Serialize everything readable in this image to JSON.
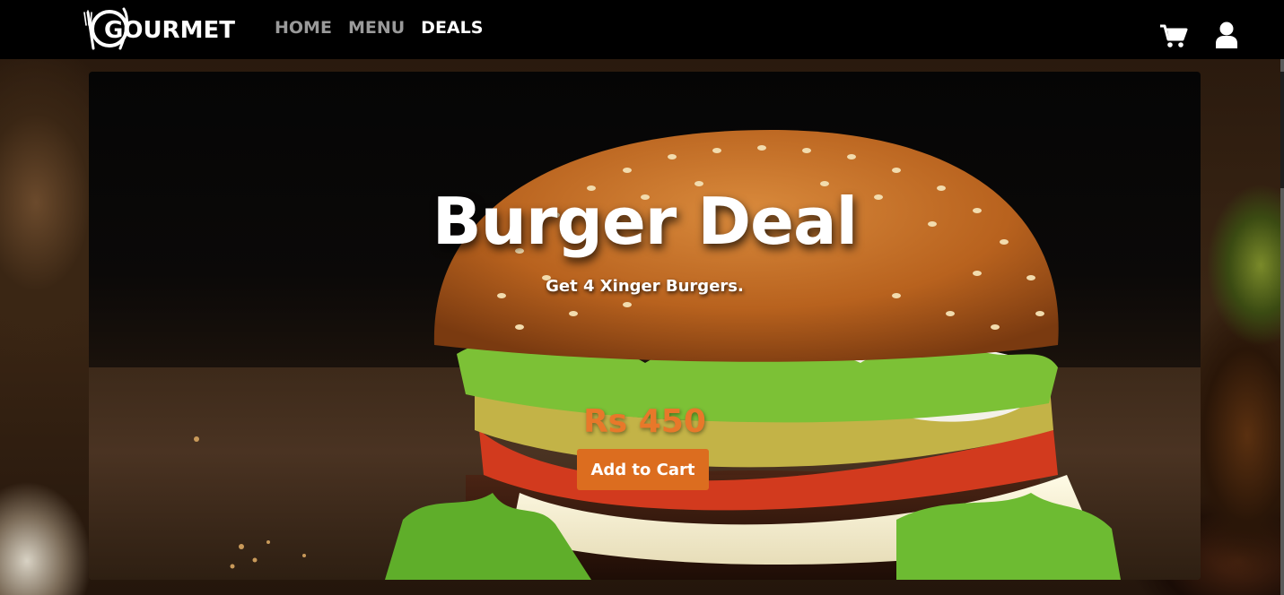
{
  "brand": {
    "name": "GOURMET"
  },
  "nav": {
    "links": [
      {
        "label": "HOME",
        "active": false
      },
      {
        "label": "MENU",
        "active": false
      },
      {
        "label": "DEALS",
        "active": true
      }
    ],
    "icons": [
      "cart-icon",
      "user-icon"
    ]
  },
  "hero": {
    "title": "Burger Deal",
    "subtitle": "Get 4 Xinger Burgers.",
    "price": "Rs 450",
    "cta_label": "Add to Cart"
  },
  "colors": {
    "navbar_bg": "#000000",
    "nav_inactive": "#9a9a9a",
    "nav_active": "#ffffff",
    "accent": "#dc6d1f",
    "price": "#e8782a"
  }
}
